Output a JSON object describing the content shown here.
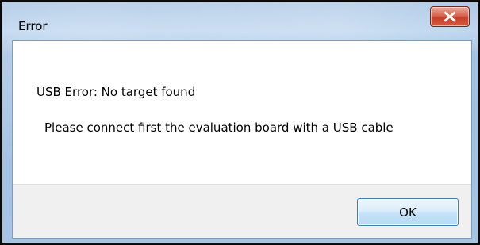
{
  "window": {
    "title": "Error",
    "close_icon": "close-x-icon",
    "colors": {
      "frame": "#a7c4e4",
      "close_button": "#c5402a",
      "client_background": "#ffffff",
      "button_bar": "#f0f0f0",
      "ok_button_border": "#3c7fb1"
    }
  },
  "message": {
    "line1": "USB Error: No target found",
    "line2": "Please connect first the evaluation board with a USB cable"
  },
  "buttons": {
    "ok_label": "OK"
  }
}
